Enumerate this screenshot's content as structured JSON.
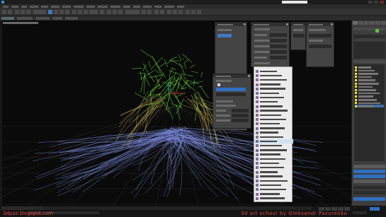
{
  "app": {
    "logo_icon": "3dsmax-logo-icon"
  },
  "credits": {
    "left": "3dpaz.blogspot.com",
    "right": "3d art school by Oleksandr Pazurenko"
  },
  "colors": {
    "strands_green": "#62d936",
    "strands_yellow": "#d9c65a",
    "strands_blue": "#7f8fe6",
    "accent_blue": "#3f79c1",
    "credit_red": "#e44848",
    "list_object_yellow": "#f2e12a"
  },
  "icons": {
    "gizmo": "transform-gizmo-icon",
    "list_item": "object-icon",
    "menu_item": "modifier-icon",
    "close": "close-icon"
  }
}
